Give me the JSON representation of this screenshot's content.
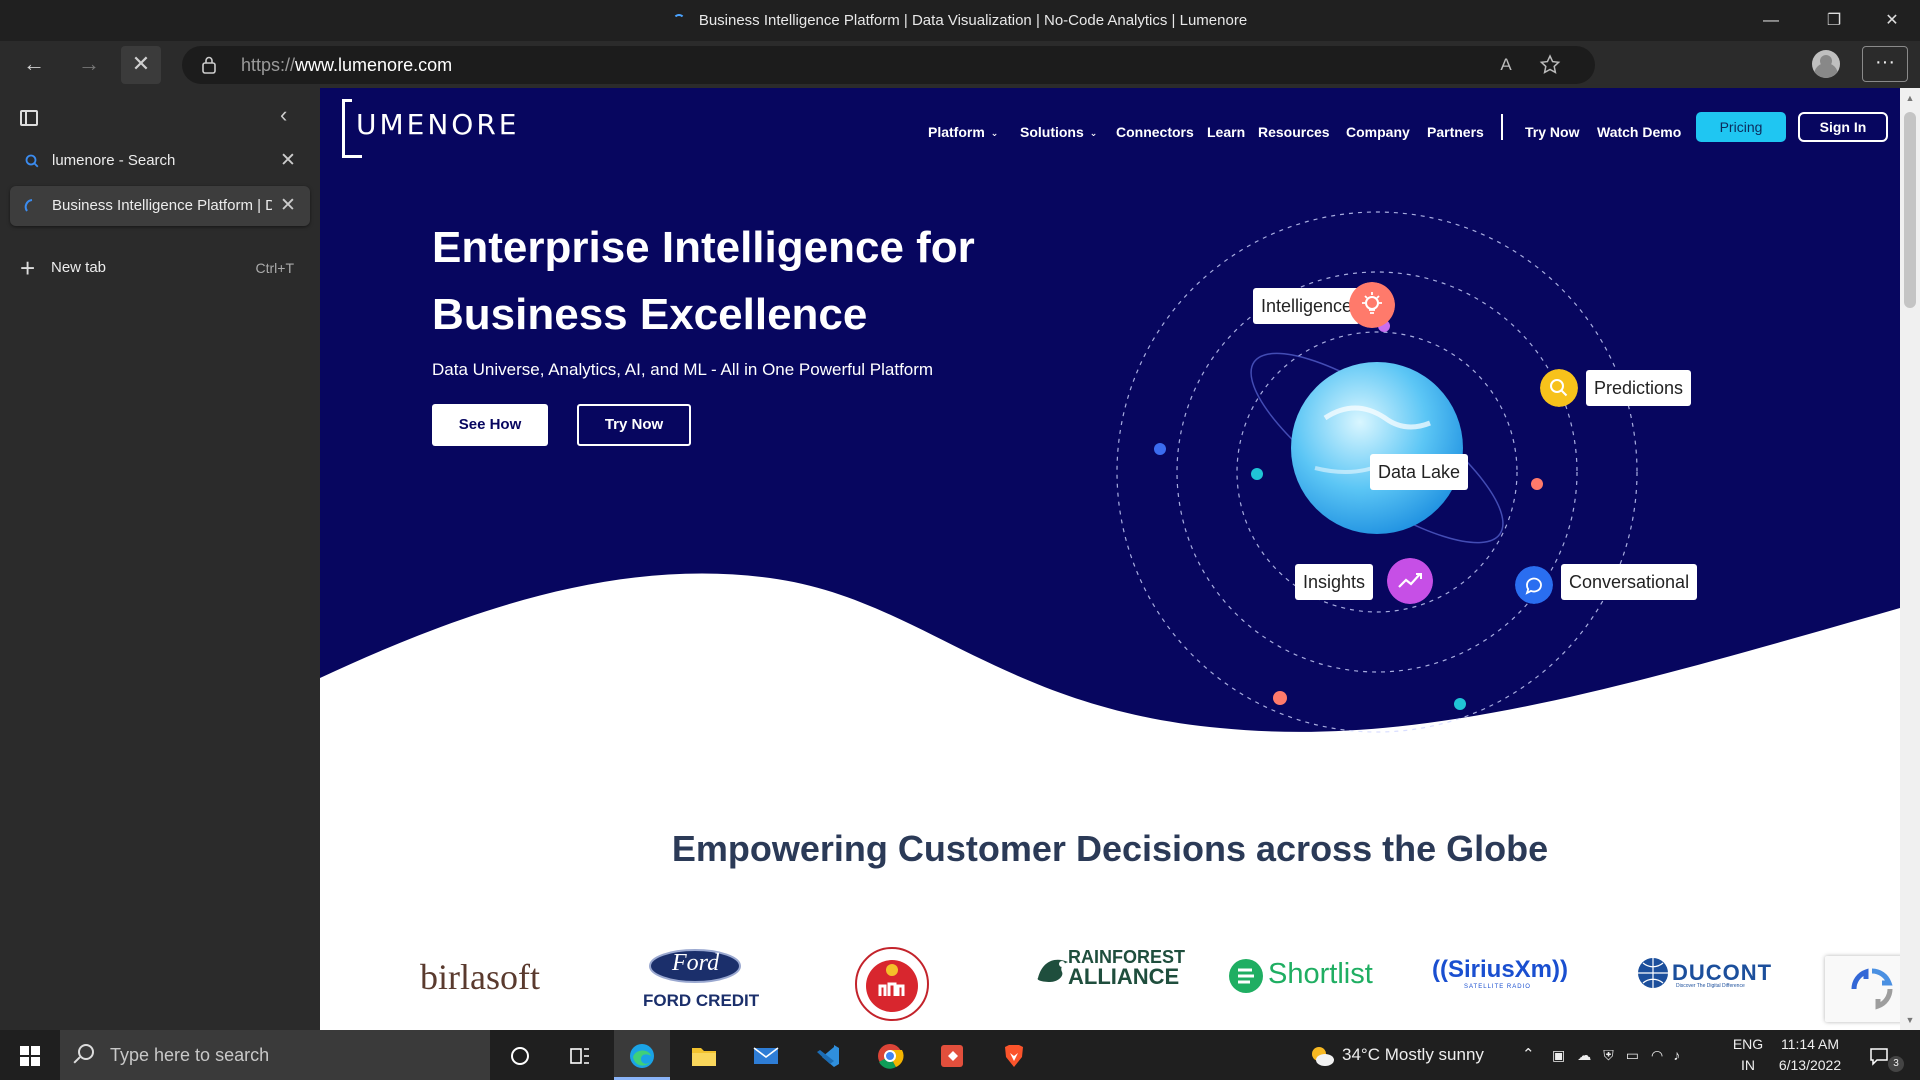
{
  "window": {
    "title": "Business Intelligence Platform | Data Visualization | No-Code Analytics | Lumenore",
    "minimize": "—",
    "restore": "❐",
    "close": "✕"
  },
  "toolbar": {
    "back": "←",
    "forward": "→",
    "stop": "✕",
    "url_scheme": "https://",
    "url_host": "www.lumenore.com",
    "read_aloud": "A",
    "more": "···"
  },
  "sidebar": {
    "collapse": "‹",
    "tabs": [
      {
        "label": "lumenore - Search",
        "close": "✕"
      },
      {
        "label": "Business Intelligence Platform | D",
        "close": "✕"
      }
    ],
    "new_tab": {
      "label": "New tab",
      "shortcut": "Ctrl+T",
      "icon": "+"
    }
  },
  "site": {
    "logo_word": "UMENORE",
    "nav": {
      "platform": "Platform",
      "solutions": "Solutions",
      "connectors": "Connectors",
      "learn": "Learn",
      "resources": "Resources",
      "company": "Company",
      "partners": "Partners",
      "try_now": "Try Now",
      "watch_demo": "Watch Demo",
      "pricing": "Pricing",
      "sign_in": "Sign In",
      "chevron": "⌄"
    },
    "hero": {
      "title_line1": "Enterprise Intelligence for",
      "title_line2": "Business Excellence",
      "subtitle": "Data Universe, Analytics, AI, and ML - All in One Powerful Platform",
      "see_how": "See How",
      "try_now": "Try Now"
    },
    "orbit_labels": {
      "intelligence": "Intelligence",
      "predictions": "Predictions",
      "data_lake": "Data Lake",
      "insights": "Insights",
      "conversational": "Conversational"
    },
    "section_title": "Empowering Customer Decisions across the Globe",
    "client_logos": {
      "birlasoft": "birlasoft",
      "ford": "Ford",
      "ford_credit": "FORD CREDIT",
      "rainforest_1": "RAINFOREST",
      "rainforest_2": "ALLIANCE",
      "shortlist": "Shortlist",
      "siriusxm": "((SiriusXm))",
      "siriusxm_tag": "SATELLITE RADIO",
      "ducont": "DUCONT",
      "ducont_tag": "Discover The Digital Difference"
    },
    "colors": {
      "hero_bg": "#07065f",
      "accent_cyan": "#1fc6f2",
      "section_title": "#2b3a57"
    }
  },
  "taskbar": {
    "search_placeholder": "Type here to search",
    "weather": "34°C  Mostly sunny",
    "lang_1": "ENG",
    "lang_2": "IN",
    "time": "11:14 AM",
    "date": "6/13/2022",
    "notif_count": "3"
  }
}
